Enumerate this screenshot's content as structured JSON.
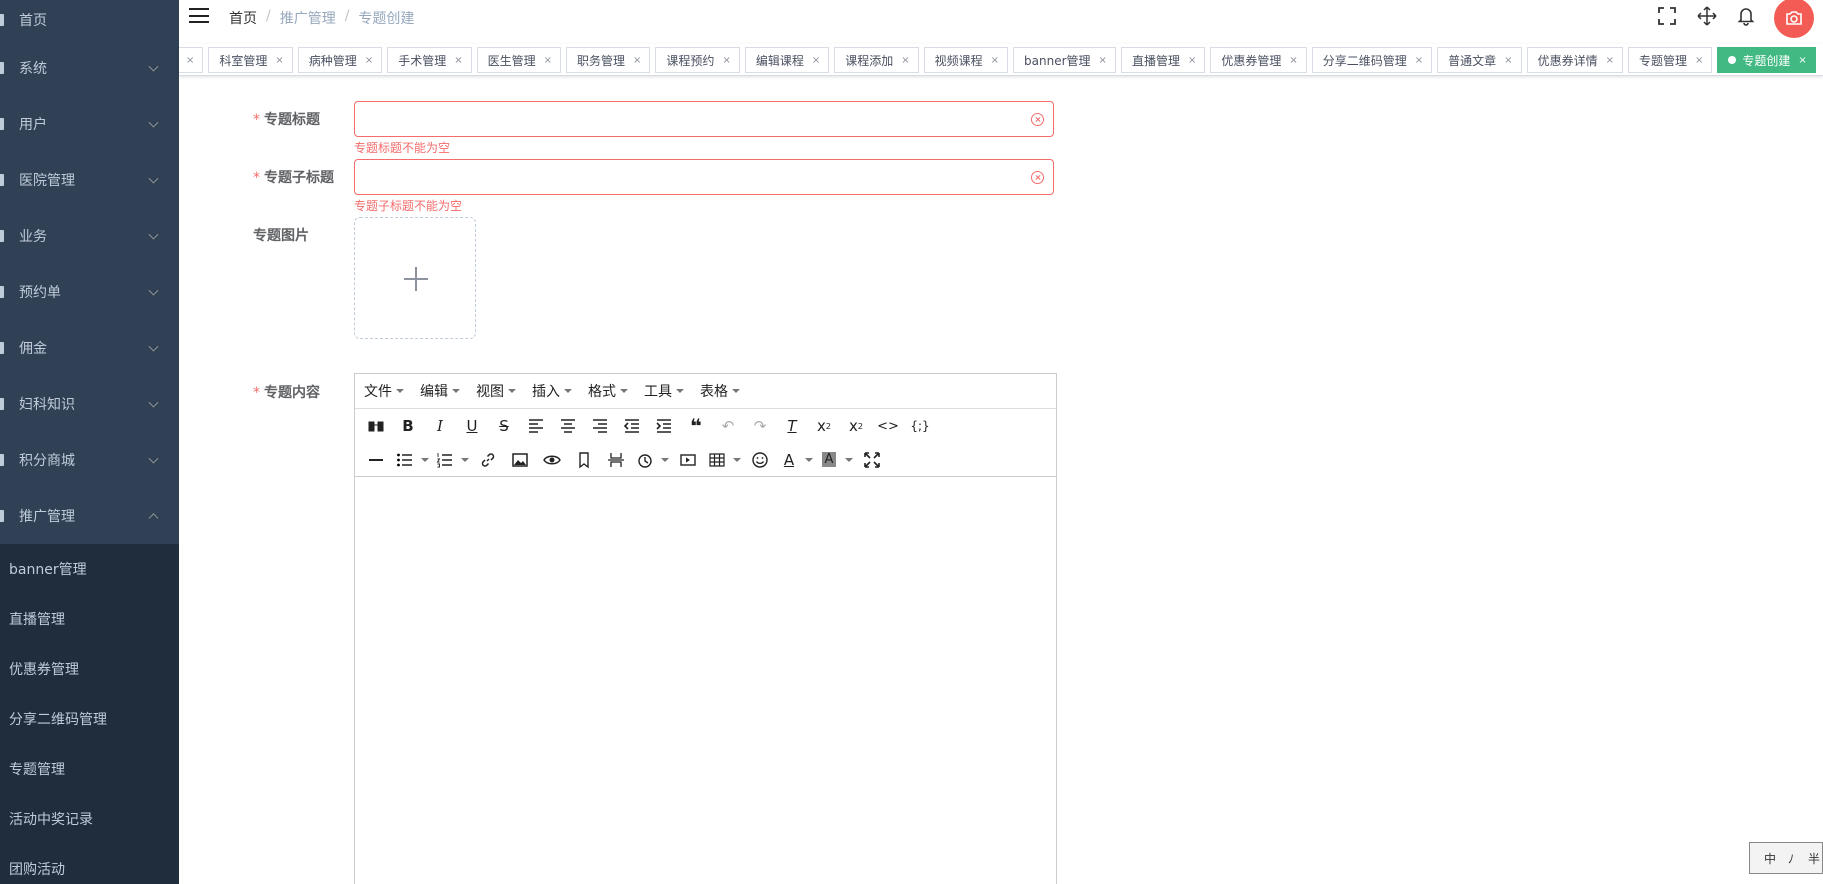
{
  "sidebar": {
    "menu": [
      {
        "label": "首页",
        "has_arrow": false
      },
      {
        "label": "系统",
        "has_arrow": true
      },
      {
        "label": "用户",
        "has_arrow": true
      },
      {
        "label": "医院管理",
        "has_arrow": true
      },
      {
        "label": "业务",
        "has_arrow": true
      },
      {
        "label": "预约单",
        "has_arrow": true
      },
      {
        "label": "佣金",
        "has_arrow": true
      },
      {
        "label": "妇科知识",
        "has_arrow": true
      },
      {
        "label": "积分商城",
        "has_arrow": true
      },
      {
        "label": "推广管理",
        "has_arrow": true,
        "open": true
      }
    ],
    "submenu": [
      "banner管理",
      "直播管理",
      "优惠券管理",
      "分享二维码管理",
      "专题管理",
      "活动中奖记录",
      "团购活动"
    ]
  },
  "breadcrumb": {
    "home": "首页",
    "parent": "推广管理",
    "current": "专题创建",
    "separator": "/"
  },
  "navbar": {
    "icons": [
      "fullscreen-icon",
      "move-icon",
      "bell-icon"
    ],
    "avatar_color": "#f25c54"
  },
  "tags": [
    "科室管理",
    "病种管理",
    "手术管理",
    "医生管理",
    "职务管理",
    "课程预约",
    "编辑课程",
    "课程添加",
    "视频课程",
    "banner管理",
    "直播管理",
    "优惠券管理",
    "分享二维码管理",
    "普通文章",
    "优惠券详情",
    "专题管理",
    "专题创建"
  ],
  "tag_close": "×",
  "active_tag_color": "#42b983",
  "form": {
    "title_label": "专题标题",
    "title_error": "专题标题不能为空",
    "subtitle_label": "专题子标题",
    "subtitle_error": "专题子标题不能为空",
    "image_label": "专题图片",
    "content_label": "专题内容",
    "required_mark": "*",
    "error_color": "#f56c6c"
  },
  "editor": {
    "menubar": [
      "文件",
      "编辑",
      "视图",
      "插入",
      "格式",
      "工具",
      "表格"
    ]
  },
  "ime": {
    "chars": [
      "中",
      "ﾉ",
      "半"
    ]
  }
}
